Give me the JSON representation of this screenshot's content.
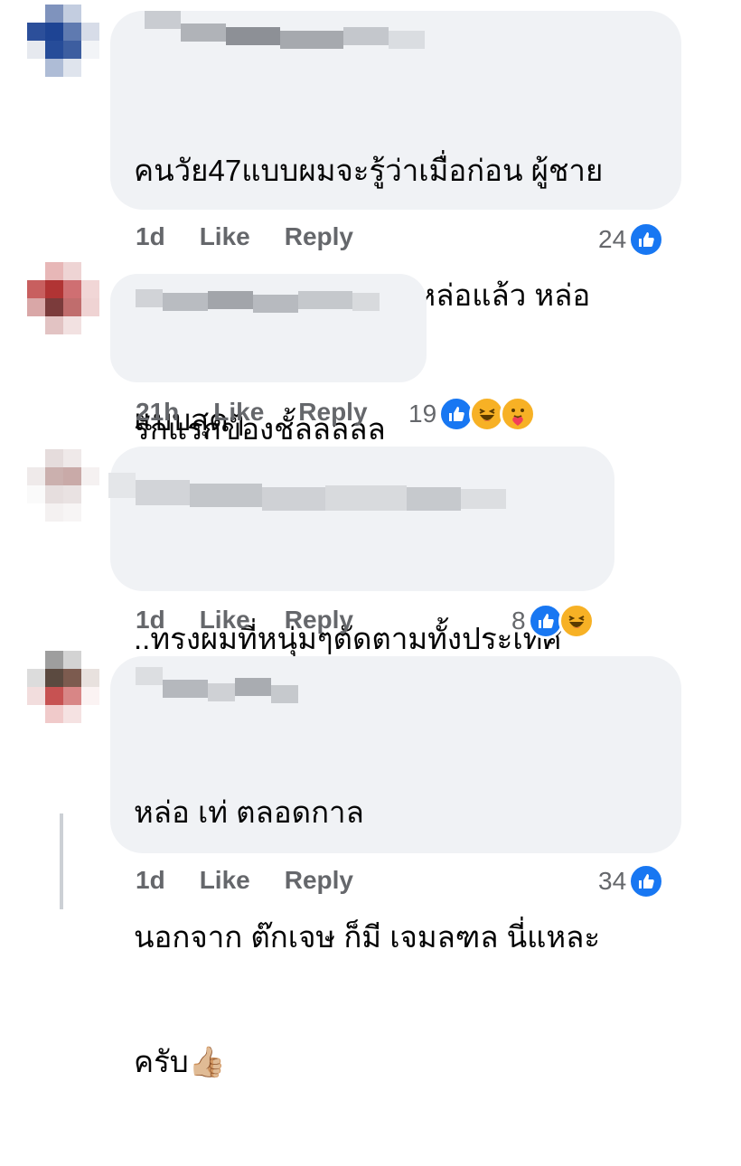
{
  "comments": [
    {
      "text_lines": [
        "คนวัย47แบบผมจะรู้ว่าเมื่อก่อน ผู้ชาย",
        "คนนี้คือที่สุดแห่งความหล่อแล้ว หล่อ",
        "แบบสุดๆ"
      ],
      "time": "1d",
      "like_label": "Like",
      "reply_label": "Reply",
      "reaction_count": "24",
      "reactions": [
        "like-icon"
      ]
    },
    {
      "text_lines": [
        "รักแรกของชั้ลลลลล"
      ],
      "time": "21h",
      "like_label": "Like",
      "reply_label": "Reply",
      "reaction_count": "19",
      "reactions": [
        "like-icon",
        "haha-icon",
        "care-icon"
      ]
    },
    {
      "text_lines": [
        "..ทรงผมที่หนุ่มๆตัดตามทั้งประเทศ"
      ],
      "time": "1d",
      "like_label": "Like",
      "reply_label": "Reply",
      "reaction_count": "8",
      "reactions": [
        "like-icon",
        "haha-icon"
      ]
    },
    {
      "text_lines": [
        "หล่อ เท่ ตลอดกาล",
        "นอกจาก ต๊กเจษ ก็มี เจมลฑล นี่แหละ",
        "ครับ👍🏼"
      ],
      "time": "1d",
      "like_label": "Like",
      "reply_label": "Reply",
      "reaction_count": "34",
      "reactions": [
        "like-icon"
      ]
    }
  ],
  "colors": {
    "bubble": "#f0f2f5",
    "meta_text": "#65676b",
    "like_blue": "#1877f2",
    "emoji_yellow": "#f7b125"
  }
}
